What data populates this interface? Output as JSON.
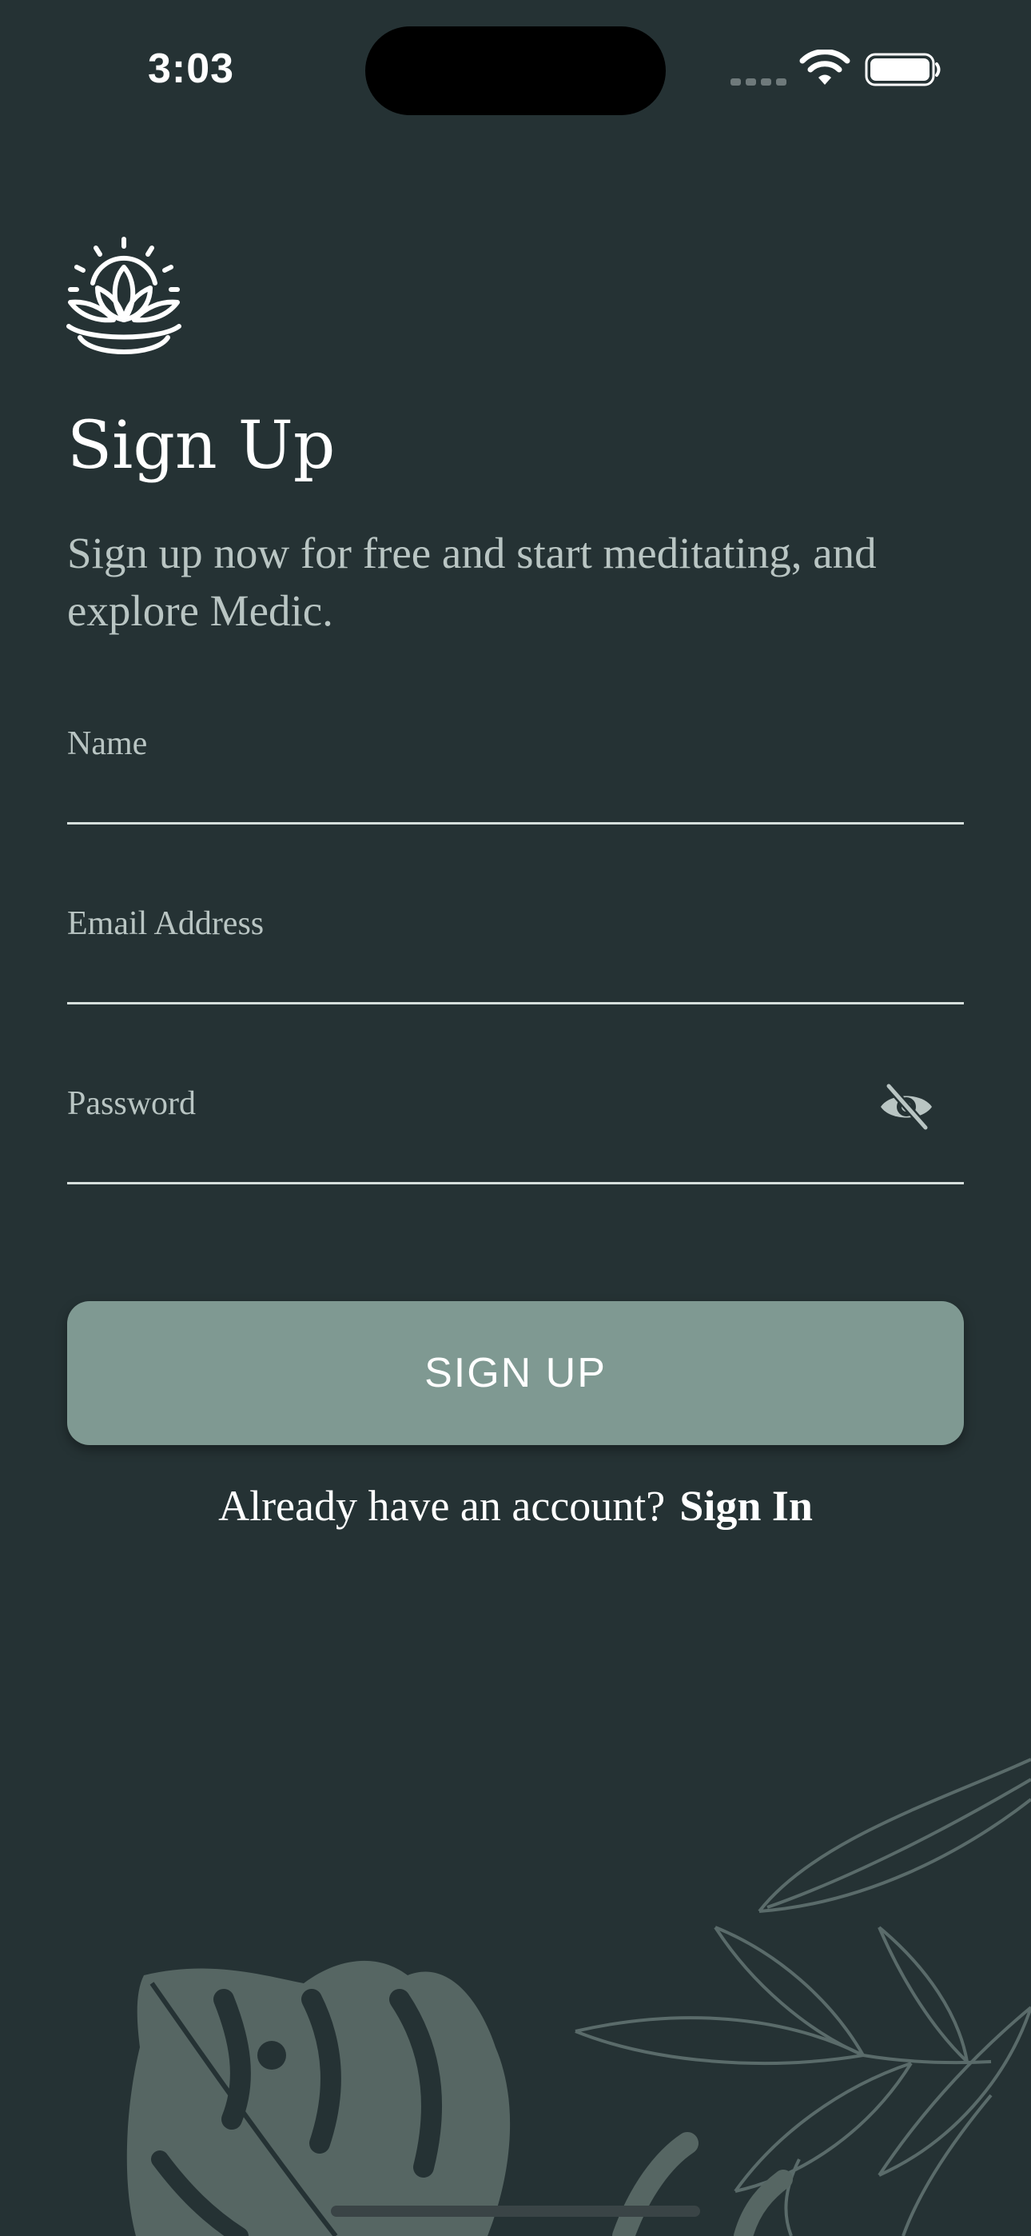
{
  "status_bar": {
    "time": "3:03"
  },
  "icons": {
    "logo": "lotus-sun-icon",
    "password_toggle": "eye-off-icon",
    "wifi": "wifi-icon",
    "battery": "battery-icon"
  },
  "header": {
    "title": "Sign Up",
    "subtitle": "Sign up now for free and start meditating, and explore Medic."
  },
  "form": {
    "name_label": "Name",
    "name_value": "",
    "email_label": "Email Address",
    "email_value": "",
    "password_label": "Password",
    "password_value": "",
    "submit_label": "SIGN UP"
  },
  "footer": {
    "prompt": "Already have an account?",
    "signin_label": "Sign In"
  },
  "colors": {
    "background": "#253234",
    "button": "#7f9992",
    "label": "#b9c5c3",
    "underline": "#d6dfdc",
    "leaf": "#5a6b6a"
  }
}
